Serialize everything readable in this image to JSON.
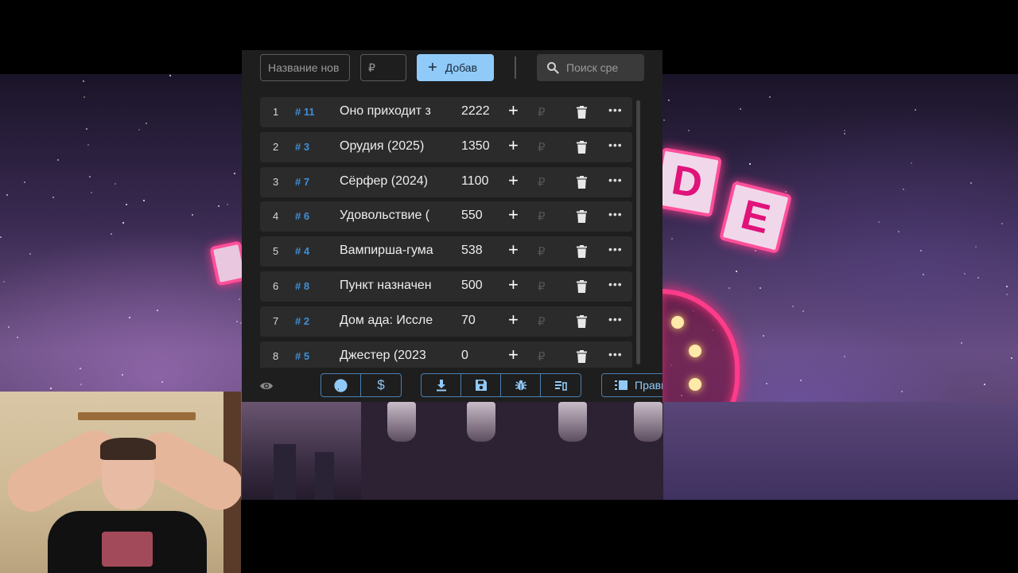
{
  "toolbar": {
    "name_placeholder": "Название нов",
    "amount_placeholder": "₽",
    "add_label": "Добав",
    "search_placeholder": "Поиск сре"
  },
  "list": {
    "currency_icon_text": "₽",
    "items": [
      {
        "index": "1",
        "tag": "# 11",
        "title": "Оно приходит з",
        "amount": "2222"
      },
      {
        "index": "2",
        "tag": "# 3",
        "title": "Орудия (2025)",
        "amount": "1350"
      },
      {
        "index": "3",
        "tag": "# 7",
        "title": "Сёрфер (2024)",
        "amount": "1100"
      },
      {
        "index": "4",
        "tag": "# 6",
        "title": "Удовольствие (",
        "amount": "550"
      },
      {
        "index": "5",
        "tag": "# 4",
        "title": "Вампирша-гума",
        "amount": "538"
      },
      {
        "index": "6",
        "tag": "# 8",
        "title": "Пункт назначен",
        "amount": "500"
      },
      {
        "index": "7",
        "tag": "# 2",
        "title": "Дом ада: Иссле",
        "amount": "70"
      },
      {
        "index": "8",
        "tag": "# 5",
        "title": "Джестер (2023",
        "amount": "0"
      }
    ]
  },
  "bottombar": {
    "rules_label": "Прави",
    "donate_symbol": "$"
  },
  "background": {
    "sign_letters": [
      "D",
      "E"
    ]
  },
  "icons": {
    "eye": "eye-icon",
    "github": "github-icon",
    "dollar": "dollar-icon",
    "download": "download-icon",
    "save": "save-icon",
    "bug": "bug-icon",
    "clear": "clear-list-icon",
    "rules": "rules-icon",
    "search": "search-icon",
    "trash": "trash-icon",
    "more": "more-icon"
  },
  "colors": {
    "accent": "#90caf9",
    "tag": "#3f8fd6",
    "panel": "#1e1e1e",
    "row": "#2b2b2b"
  }
}
